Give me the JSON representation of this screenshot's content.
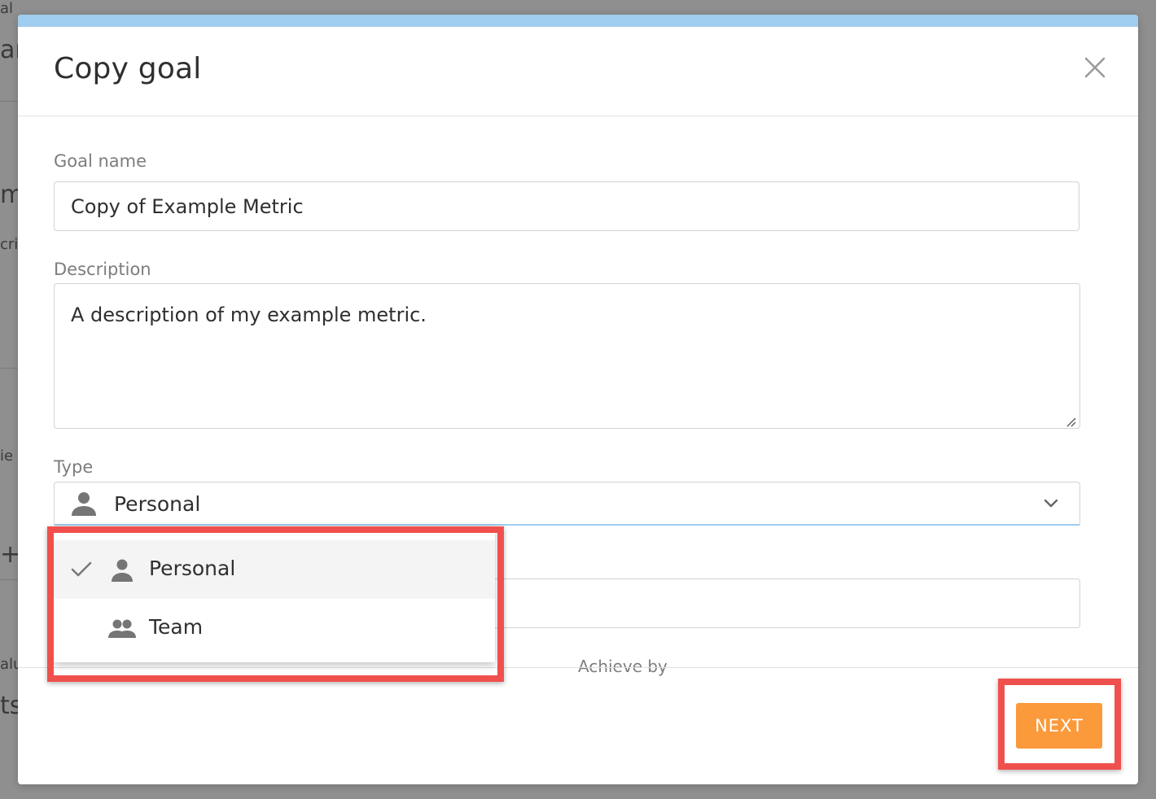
{
  "background": {
    "fragments": [
      "al",
      "ar",
      "m",
      "cri",
      "ie",
      "+",
      "alu",
      "ts"
    ]
  },
  "modal": {
    "title": "Copy goal",
    "close_icon": "close-icon",
    "accent_color": "#9fcdef",
    "fields": {
      "goal_name": {
        "label": "Goal name",
        "value": "Copy of Example Metric"
      },
      "description": {
        "label": "Description",
        "value": "A description of my example metric."
      },
      "type": {
        "label": "Type",
        "selected": "Personal",
        "icon": "person-icon"
      },
      "achieve_by": {
        "label": "Achieve by"
      }
    },
    "type_options": [
      {
        "label": "Personal",
        "icon": "person-icon",
        "selected": true
      },
      {
        "label": "Team",
        "icon": "group-icon",
        "selected": false
      }
    ],
    "footer": {
      "next_label": "NEXT",
      "next_color": "#fb9a3b"
    },
    "highlight_color": "#f0504d"
  }
}
